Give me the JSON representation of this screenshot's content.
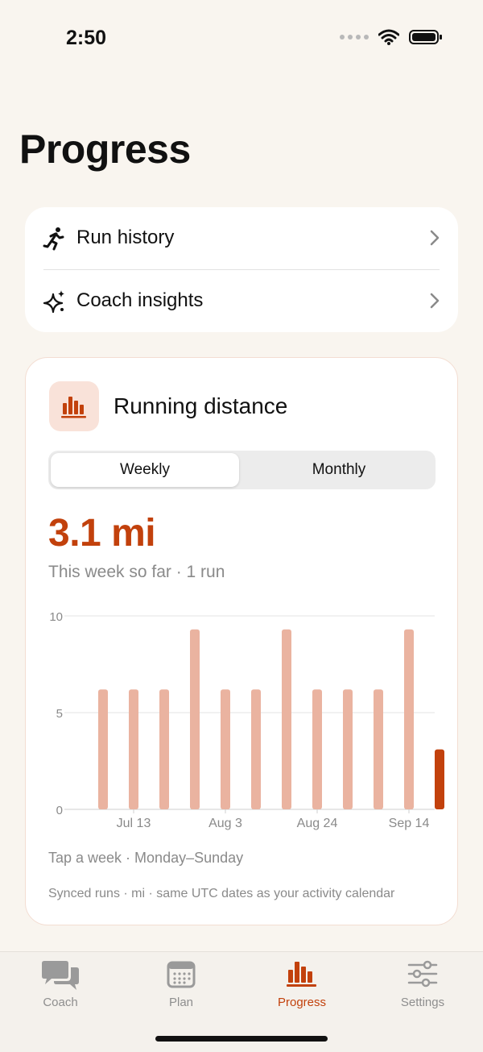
{
  "status_bar": {
    "time": "2:50"
  },
  "page": {
    "title": "Progress"
  },
  "nav_list": {
    "items": [
      {
        "label": "Run history",
        "icon": "runner-icon"
      },
      {
        "label": "Coach insights",
        "icon": "sparkles-icon"
      }
    ]
  },
  "distance_card": {
    "title": "Running distance",
    "icon": "bar-chart-icon",
    "segments": {
      "weekly": "Weekly",
      "monthly": "Monthly",
      "selected": "Weekly"
    },
    "value": "3.1 mi",
    "subtitle": "This week so far · 1 run",
    "footnote_primary": "Tap a week · Monday–Sunday",
    "footnote_secondary": "Synced runs · mi · same UTC dates as your activity calendar"
  },
  "chart_data": {
    "type": "bar",
    "y_ticks": [
      "10",
      "5",
      "0"
    ],
    "ylim": [
      0,
      10
    ],
    "x_tick_labels": [
      "Jul 13",
      "Aug 3",
      "Aug 24",
      "Sep 14"
    ],
    "values": [
      6.2,
      6.2,
      6.2,
      9.3,
      6.2,
      6.2,
      9.3,
      6.2,
      6.2,
      6.2,
      9.3,
      3.1
    ],
    "highlight_index": 11,
    "colors": {
      "bar": "#eab3a0",
      "highlight": "#c2410c",
      "grid": "#e3e3e3"
    },
    "grid": true
  },
  "tab_bar": {
    "tabs": [
      {
        "label": "Coach",
        "icon": "chat-bubbles-icon"
      },
      {
        "label": "Plan",
        "icon": "calendar-icon"
      },
      {
        "label": "Progress",
        "icon": "bar-chart-icon"
      },
      {
        "label": "Settings",
        "icon": "sliders-icon"
      }
    ],
    "active": "Progress",
    "accent": "#c2410c"
  }
}
